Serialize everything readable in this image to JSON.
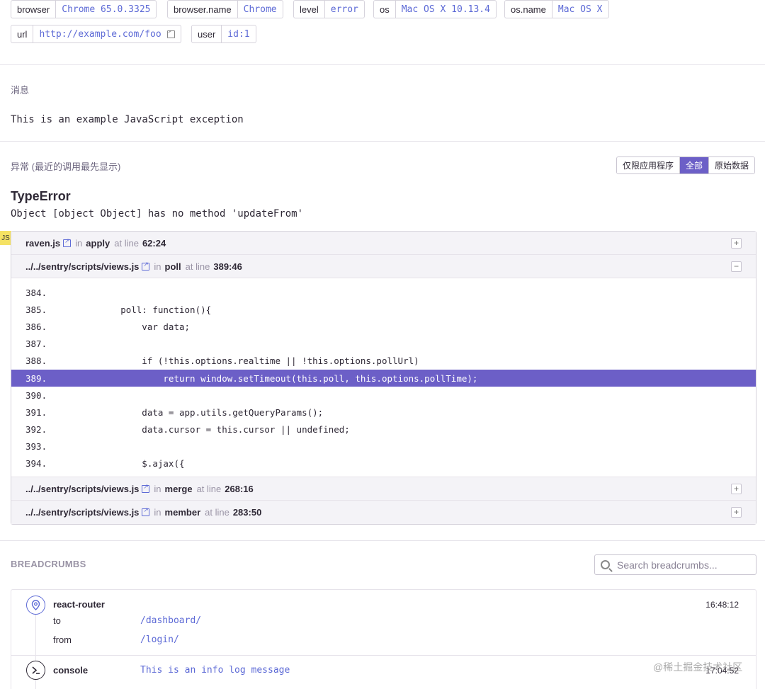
{
  "tags": [
    {
      "key": "browser",
      "value": "Chrome 65.0.3325"
    },
    {
      "key": "browser.name",
      "value": "Chrome"
    },
    {
      "key": "level",
      "value": "error"
    },
    {
      "key": "os",
      "value": "Mac OS X 10.13.4"
    },
    {
      "key": "os.name",
      "value": "Mac OS X"
    },
    {
      "key": "url",
      "value": "http://example.com/foo"
    },
    {
      "key": "user",
      "value": "id:1"
    }
  ],
  "message": {
    "title": "消息",
    "text": "This is an example JavaScript exception"
  },
  "exception": {
    "title": "异常 (最近的调用最先显示)",
    "toggle_buttons": [
      "仅限应用程序",
      "全部",
      "原始数据"
    ],
    "active_toggle": "全部",
    "type": "TypeError",
    "value": "Object [object Object] has no method 'updateFrom'",
    "platform_badge": "JS",
    "in_label": "in",
    "at_line_label": "at line",
    "frames": [
      {
        "file": "raven.js",
        "function": "apply",
        "line": "62:24",
        "expanded": false
      },
      {
        "file": "../../sentry/scripts/views.js",
        "function": "poll",
        "line": "389:46",
        "expanded": true,
        "code": [
          {
            "num": "384.",
            "text": ""
          },
          {
            "num": "385.",
            "text": "        poll: function(){"
          },
          {
            "num": "386.",
            "text": "            var data;"
          },
          {
            "num": "387.",
            "text": ""
          },
          {
            "num": "388.",
            "text": "            if (!this.options.realtime || !this.options.pollUrl)"
          },
          {
            "num": "389.",
            "text": "                return window.setTimeout(this.poll, this.options.pollTime);",
            "highlight": true
          },
          {
            "num": "390.",
            "text": ""
          },
          {
            "num": "391.",
            "text": "            data = app.utils.getQueryParams();"
          },
          {
            "num": "392.",
            "text": "            data.cursor = this.cursor || undefined;"
          },
          {
            "num": "393.",
            "text": ""
          },
          {
            "num": "394.",
            "text": "            $.ajax({"
          }
        ]
      },
      {
        "file": "../../sentry/scripts/views.js",
        "function": "merge",
        "line": "268:16",
        "expanded": false
      },
      {
        "file": "../../sentry/scripts/views.js",
        "function": "member",
        "line": "283:50",
        "expanded": false
      }
    ]
  },
  "breadcrumbs": {
    "title": "BREADCRUMBS",
    "search_placeholder": "Search breadcrumbs...",
    "items": [
      {
        "category": "react-router",
        "icon": "location-pin-icon",
        "time": "16:48:12",
        "data": [
          {
            "key": "to",
            "value": "/dashboard/"
          },
          {
            "key": "from",
            "value": "/login/"
          }
        ]
      },
      {
        "category": "console",
        "icon": "terminal-icon",
        "time": "17:04:52",
        "message": "This is an info log message"
      }
    ]
  },
  "watermark": "@稀土掘金技术社区",
  "colors": {
    "accent": "#6c5fc7",
    "link": "#5d6ad6",
    "js_badge": "#f5e264"
  }
}
